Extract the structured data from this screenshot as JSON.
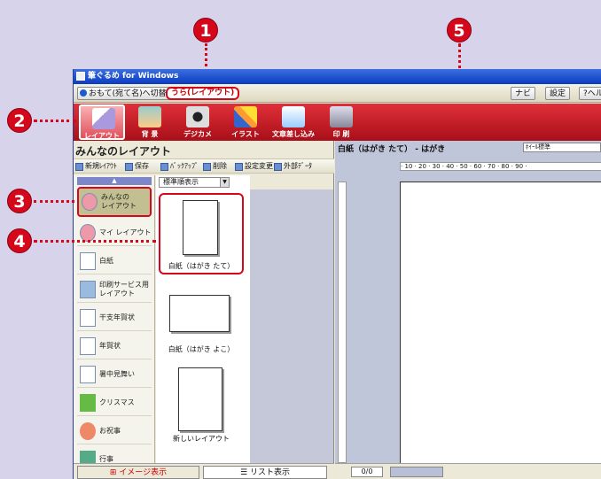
{
  "window": {
    "title": "筆ぐるめ for Windows"
  },
  "modes": {
    "front": "おもて(宛て名)へ切替",
    "back": "うら(レイアウト)"
  },
  "helpbar": {
    "navi": "ナビ",
    "settings": "設定",
    "help": "?ヘル"
  },
  "toolbar": [
    {
      "label": "レイアウト"
    },
    {
      "label": "背 景"
    },
    {
      "label": "デジカメ"
    },
    {
      "label": "イラスト"
    },
    {
      "label": "文章差し込み"
    },
    {
      "label": "印 刷"
    }
  ],
  "leftpane": {
    "title": "みんなのレイアウト",
    "buttons": [
      "新規ﾚｲｱｳﾄ",
      "保存",
      "ﾊﾞｯｸｱｯﾌﾟ",
      "削除",
      "設定変更",
      "外部ﾃﾞｰﾀ"
    ],
    "sort": "標準順表示",
    "scroll_up": "▲",
    "scroll_down": "▼",
    "categories": [
      {
        "label": "みんなの\nレイアウト"
      },
      {
        "label": "マイ レイアウト"
      },
      {
        "label": "白紙"
      },
      {
        "label": "印刷サービス用\nレイアウト"
      },
      {
        "label": "干支年賀状"
      },
      {
        "label": "年賀状"
      },
      {
        "label": "暑中見舞い"
      },
      {
        "label": "クリスマス"
      },
      {
        "label": "お祝事"
      },
      {
        "label": "行事"
      }
    ],
    "thumbs": [
      {
        "caption": "白紙（はがき たて）"
      },
      {
        "caption": "白紙（はがき よこ）"
      },
      {
        "caption": "新しいレイアウト"
      }
    ],
    "tabs": {
      "image": "イメージ表示",
      "list": "リスト表示"
    }
  },
  "rightpane": {
    "title": "白紙（はがき たて） - はがき",
    "zoom": "ﾎｲｰﾙ標準",
    "hruler": "· 10 · 20 · 30 · 40 · 50 · 60 · 70 · 80 · 90 ·",
    "page": "0/0"
  },
  "callouts": [
    "1",
    "2",
    "3",
    "4",
    "5"
  ],
  "colors": {
    "accent": "#d5081b",
    "toolbar": "#c8202a",
    "background": "#d6d3ea"
  }
}
